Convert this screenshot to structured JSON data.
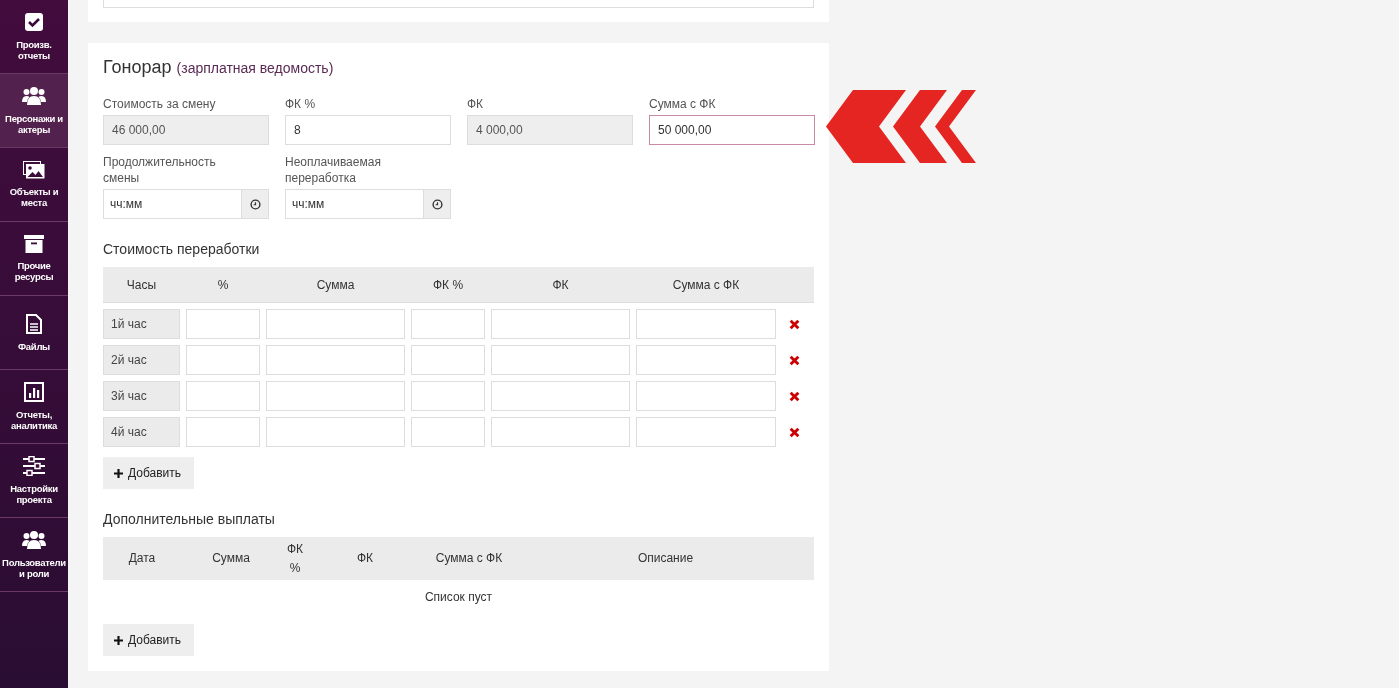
{
  "sidebar": {
    "items": [
      {
        "label": "Произв. отчеты",
        "selected": false
      },
      {
        "label": "Персонажи и актеры",
        "selected": true
      },
      {
        "label": "Объекты и места",
        "selected": false
      },
      {
        "label": "Прочие ресурсы",
        "selected": false
      },
      {
        "label": "Файлы",
        "selected": false
      },
      {
        "label": "Отчеты, аналитика",
        "selected": false
      },
      {
        "label": "Настройки проекта",
        "selected": false
      },
      {
        "label": "Пользователи и роли",
        "selected": false
      }
    ]
  },
  "fee": {
    "title": "Гонорар",
    "subtitle": "(зарплатная ведомость)",
    "fields": [
      {
        "kind": "text",
        "label": "Стоимость за смену",
        "value": "46 000,00",
        "readonly": true,
        "focused": false
      },
      {
        "kind": "text",
        "label": "ФК %",
        "value": "8",
        "readonly": false,
        "focused": false
      },
      {
        "kind": "text",
        "label": "ФК",
        "value": "4 000,00",
        "readonly": true,
        "focused": false
      },
      {
        "kind": "text",
        "label": "Сумма с ФК",
        "value": "50 000,00",
        "readonly": false,
        "focused": true
      },
      {
        "kind": "time",
        "label": "Продолжительность смены",
        "placeholder": "чч:мм",
        "readonly": false,
        "focused": false
      },
      {
        "kind": "time",
        "label": "Неоплачиваемая переработка",
        "placeholder": "чч:мм",
        "readonly": false,
        "focused": false
      }
    ]
  },
  "overtime": {
    "title": "Стоимость переработки",
    "columns": [
      "Часы",
      "%",
      "Сумма",
      "ФК %",
      "ФК",
      "Сумма с ФК"
    ],
    "rows": [
      {
        "hour": "1й час"
      },
      {
        "hour": "2й час"
      },
      {
        "hour": "3й час"
      },
      {
        "hour": "4й час"
      }
    ],
    "add_button": "Добавить"
  },
  "extra_payments": {
    "title": "Дополнительные выплаты",
    "columns": [
      "Дата",
      "Сумма",
      "ФК %",
      "ФК",
      "Сумма с ФК",
      "Описание"
    ],
    "empty_text": "Список пуст",
    "add_button": "Добавить"
  }
}
